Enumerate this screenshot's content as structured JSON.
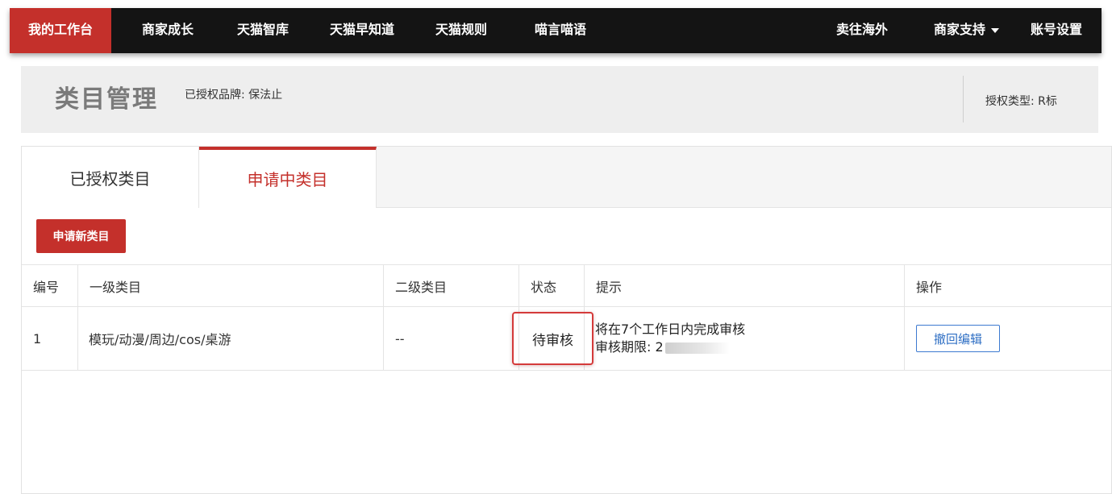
{
  "nav": {
    "items": [
      "我的工作台",
      "商家成长",
      "天猫智库",
      "天猫早知道",
      "天猫规则",
      "喵言喵语"
    ],
    "right_items": [
      "卖往海外",
      "商家支持",
      "账号设置"
    ]
  },
  "header": {
    "title": "类目管理",
    "brand_label": "已授权品牌: 保法止",
    "auth_type": "授权类型: R标"
  },
  "tabs": [
    "已授权类目",
    "申请中类目"
  ],
  "apply_button": "申请新类目",
  "table": {
    "headers": [
      "编号",
      "一级类目",
      "二级类目",
      "状态",
      "提示",
      "操作"
    ],
    "rows": [
      {
        "id": "1",
        "category1": "模玩/动漫/周边/cos/桌游",
        "category2": "--",
        "status": "待审核",
        "hint_line1": "将在7个工作日内完成审核",
        "hint_line2": "审核期限: 2",
        "action": "撤回编辑"
      }
    ]
  },
  "colors": {
    "accent": "#c4302b",
    "nav_bg": "#141414",
    "link_blue": "#2f6fc4"
  }
}
